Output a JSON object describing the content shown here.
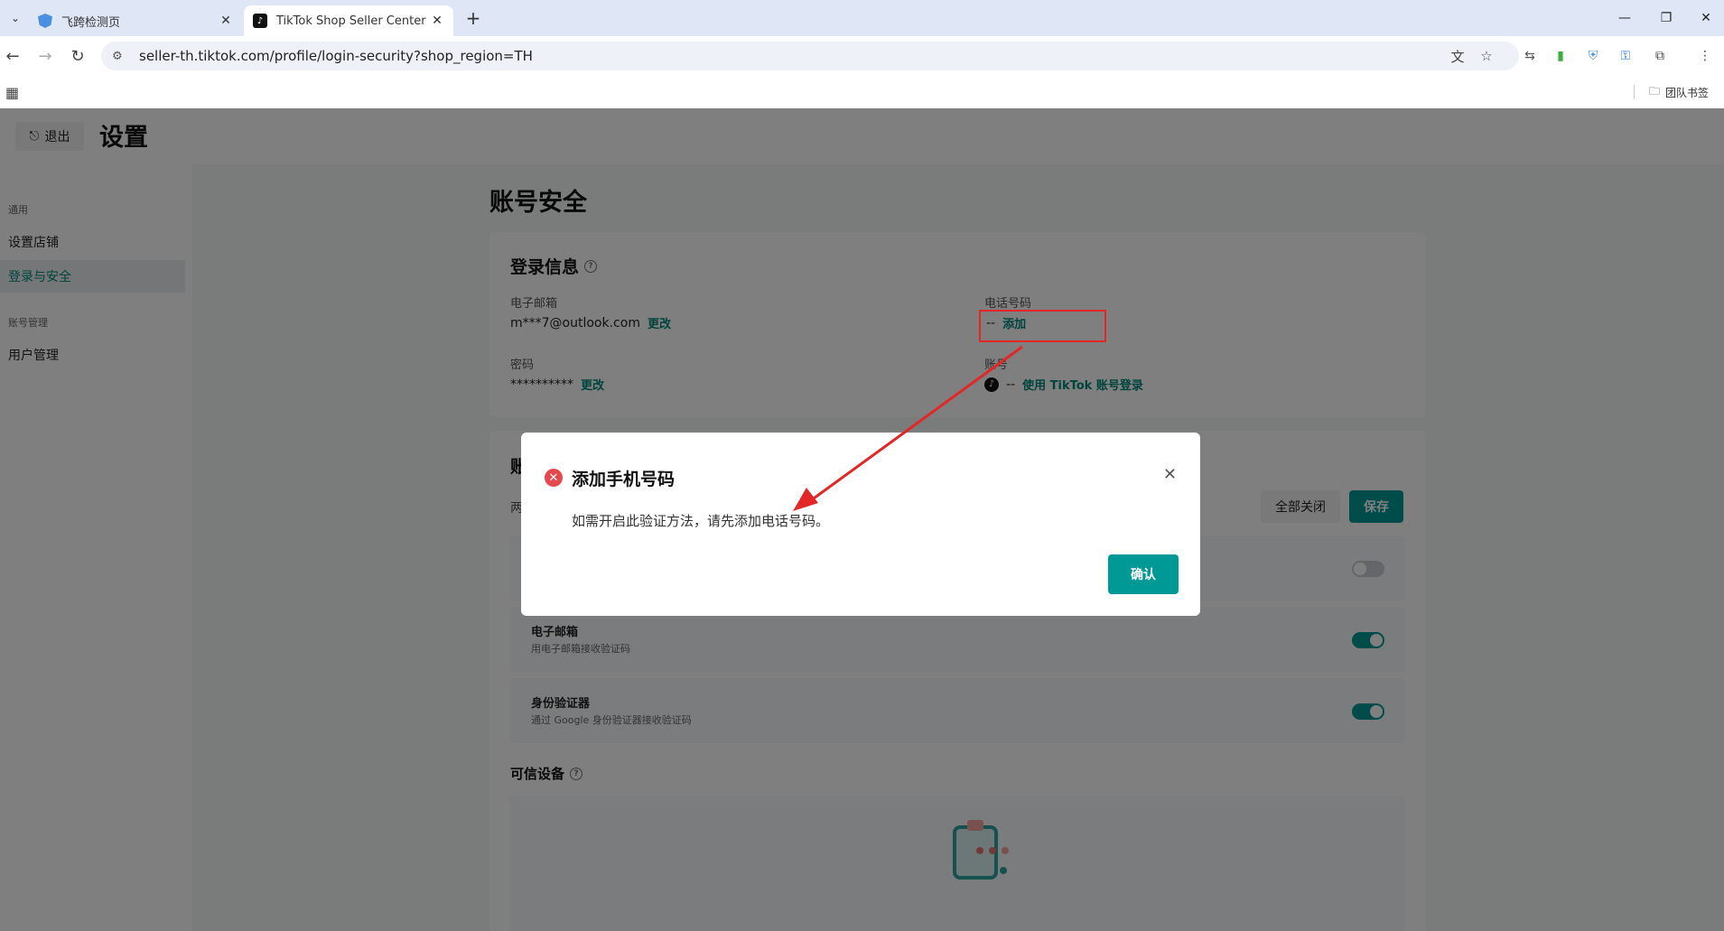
{
  "browser": {
    "tabs": [
      {
        "title": "飞跨检测页",
        "active": false
      },
      {
        "title": "TikTok Shop Seller Center | TH",
        "active": true
      }
    ],
    "url": "seller-th.tiktok.com/profile/login-security?shop_region=TH",
    "bookmark_folder": "团队书签"
  },
  "header": {
    "logout_label": "退出",
    "title": "设置"
  },
  "sidebar": {
    "groups": [
      {
        "label": "通用",
        "items": [
          "设置店铺",
          "登录与安全"
        ]
      },
      {
        "label": "账号管理",
        "items": [
          "用户管理"
        ]
      }
    ],
    "active_item": "登录与安全"
  },
  "main": {
    "section_title": "账号安全",
    "login_info": {
      "title": "登录信息",
      "email_label": "电子邮箱",
      "email_value": "m***7@outlook.com",
      "email_action": "更改",
      "phone_label": "电话号码",
      "phone_value": "--",
      "phone_action": "添加",
      "password_label": "密码",
      "password_value": "**********",
      "password_action": "更改",
      "account_label": "账号",
      "account_value": "--",
      "account_action": "使用 TikTok 账号登录"
    },
    "verification": {
      "title_partial": "账",
      "sub_partial": "两",
      "close_all": "全部关闭",
      "save": "保存",
      "options": [
        {
          "title": "",
          "subtitle": "",
          "enabled": false
        },
        {
          "title": "电子邮箱",
          "subtitle": "用电子邮箱接收验证码",
          "enabled": true
        },
        {
          "title": "身份验证器",
          "subtitle": "通过 Google 身份验证器接收验证码",
          "enabled": true
        }
      ]
    },
    "trusted_devices": {
      "title": "可信设备"
    }
  },
  "modal": {
    "title": "添加手机号码",
    "body": "如需开启此验证方法，请先添加电话号码。",
    "confirm": "确认"
  },
  "colors": {
    "brand": "#009995",
    "error": "#e5484d",
    "annotation": "#e32727"
  }
}
